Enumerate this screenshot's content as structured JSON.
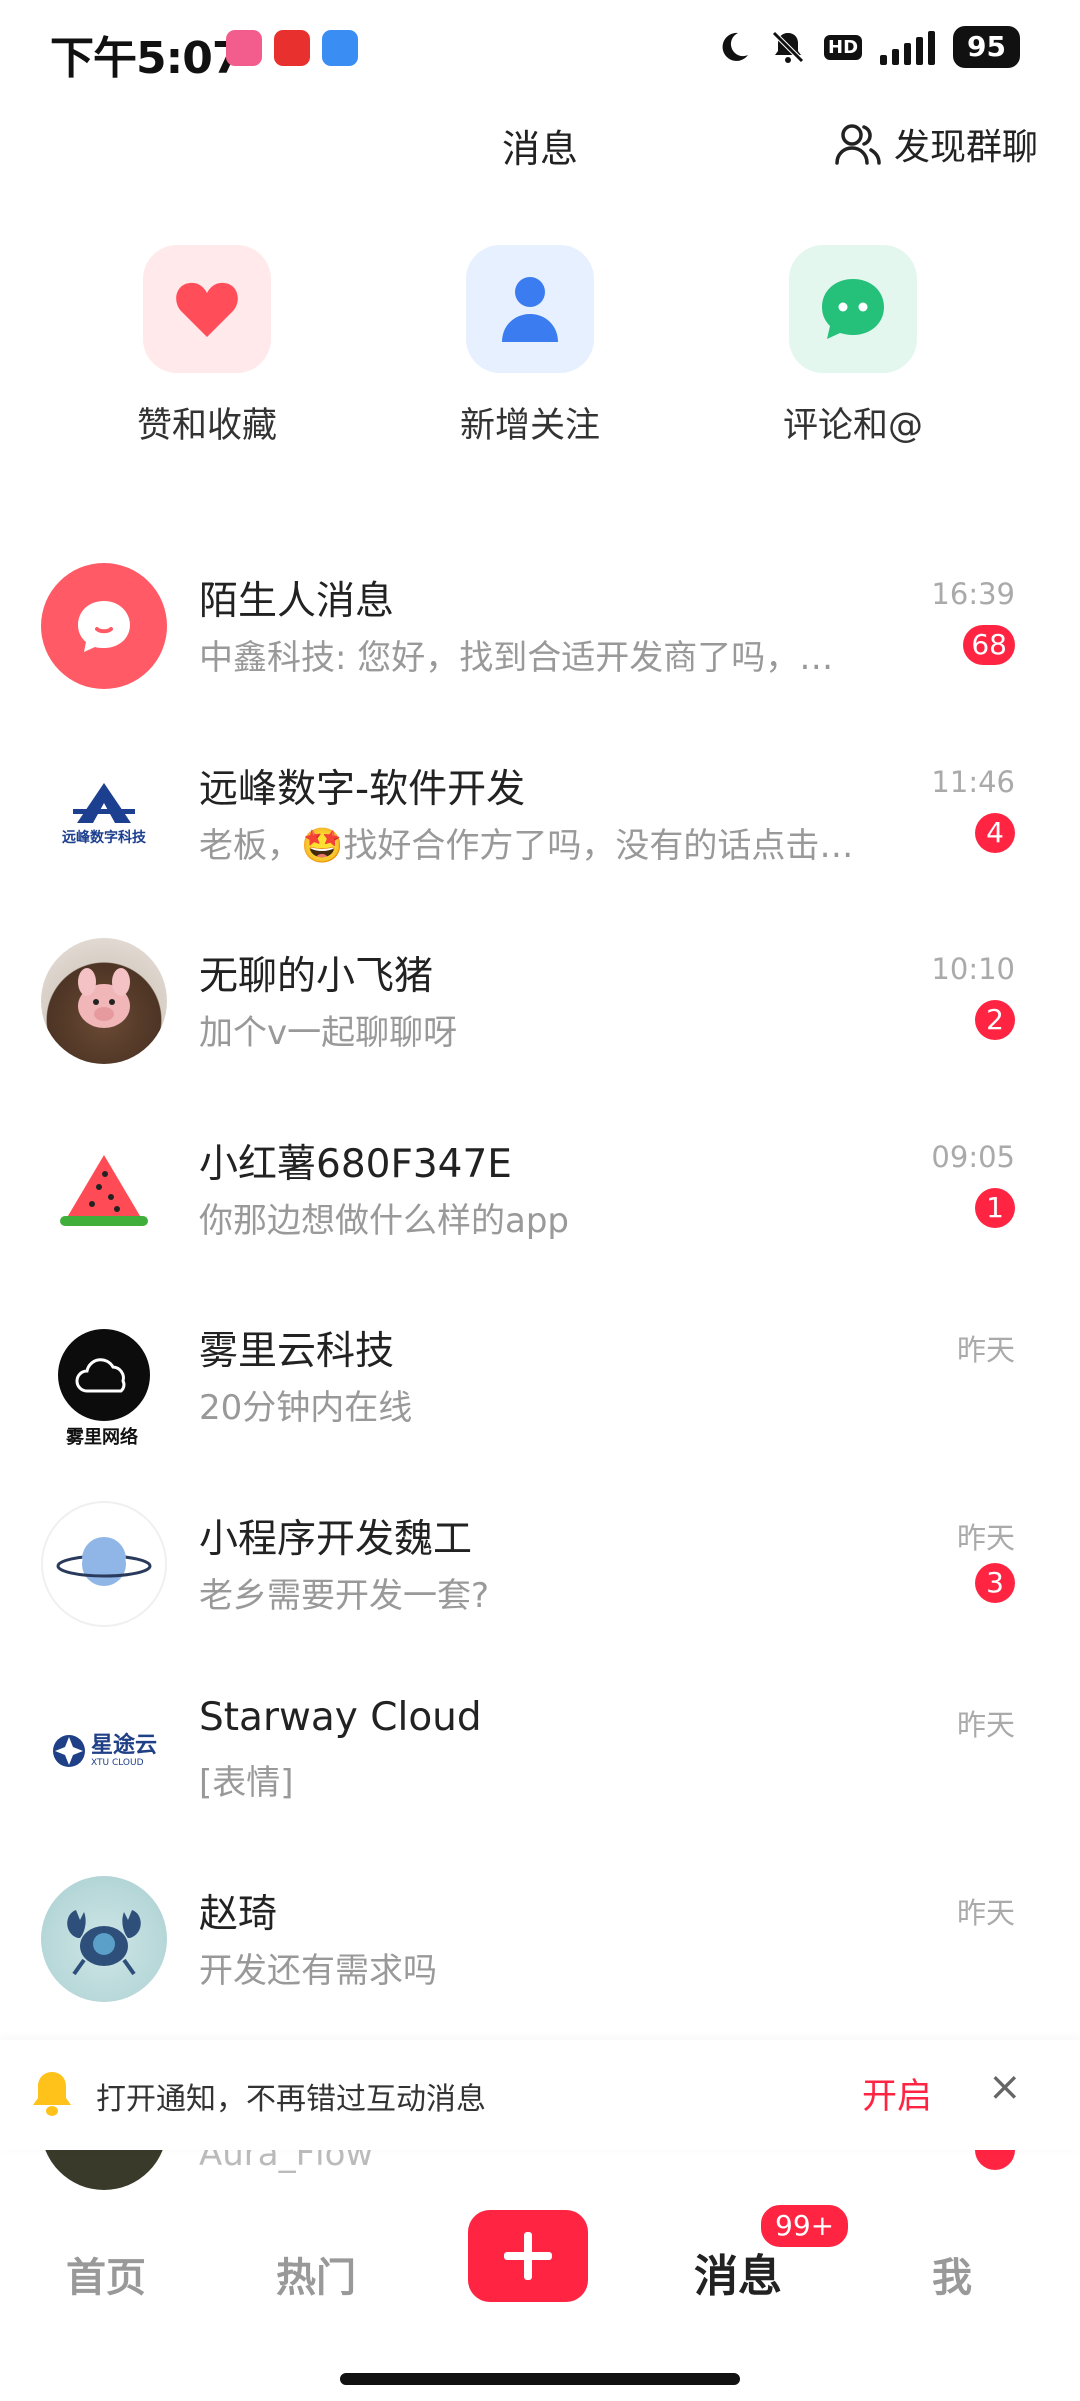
{
  "status_bar": {
    "time": "下午5:07",
    "battery": "95",
    "net_label": "HD"
  },
  "header": {
    "title": "消息",
    "discover_label": "发现群聊"
  },
  "quick_entries": [
    {
      "label": "赞和收藏",
      "icon": "heart-icon",
      "color": "#ff4d5a"
    },
    {
      "label": "新增关注",
      "icon": "user-icon",
      "color": "#3b7cf0"
    },
    {
      "label": "评论和@",
      "icon": "chat-bubble-icon",
      "color": "#25c07a"
    }
  ],
  "conversations": [
    {
      "name": "陌生人消息",
      "message": "中鑫科技: 您好，找到合适开发商了吗，…",
      "time": "16:39",
      "badge": "68",
      "avatar": "stranger-message-icon"
    },
    {
      "name": "远峰数字-软件开发",
      "message": "老板，🤩找好合作方了吗，没有的话点击…",
      "time": "11:46",
      "badge": "4",
      "avatar": "company-logo",
      "avatar_text": "远峰数字科技"
    },
    {
      "name": "无聊的小飞猪",
      "message": "加个v一起聊聊呀",
      "time": "10:10",
      "badge": "2",
      "avatar": "pig-toy-avatar"
    },
    {
      "name": "小红薯680F347E",
      "message": "你那边想做什么样的app",
      "time": "09:05",
      "badge": "1",
      "avatar": "watermelon-avatar"
    },
    {
      "name": "雾里云科技",
      "message": "20分钟内在线",
      "time": "昨天",
      "badge": "",
      "avatar": "cloud-logo",
      "avatar_text": "雾里网络"
    },
    {
      "name": "小程序开发魏工",
      "message": "老乡需要开发一套?",
      "time": "昨天",
      "badge": "3",
      "avatar": "planet-avatar"
    },
    {
      "name": "Starway Cloud",
      "message": "[表情]",
      "time": "昨天",
      "badge": "",
      "avatar": "starway-logo",
      "avatar_text": "星途云",
      "avatar_sub": "XTU CLOUD"
    },
    {
      "name": "赵琦",
      "message": "开发还有需求吗",
      "time": "昨天",
      "badge": "",
      "avatar": "crab-avatar"
    }
  ],
  "peek_row": {
    "name": "Aura_Flow"
  },
  "banner": {
    "text": "打开通知，不再错过互动消息",
    "action": "开启"
  },
  "tabbar": {
    "home": "首页",
    "hot": "热门",
    "messages": "消息",
    "messages_badge": "99+",
    "me": "我"
  },
  "colors": {
    "accent": "#ff2442"
  }
}
